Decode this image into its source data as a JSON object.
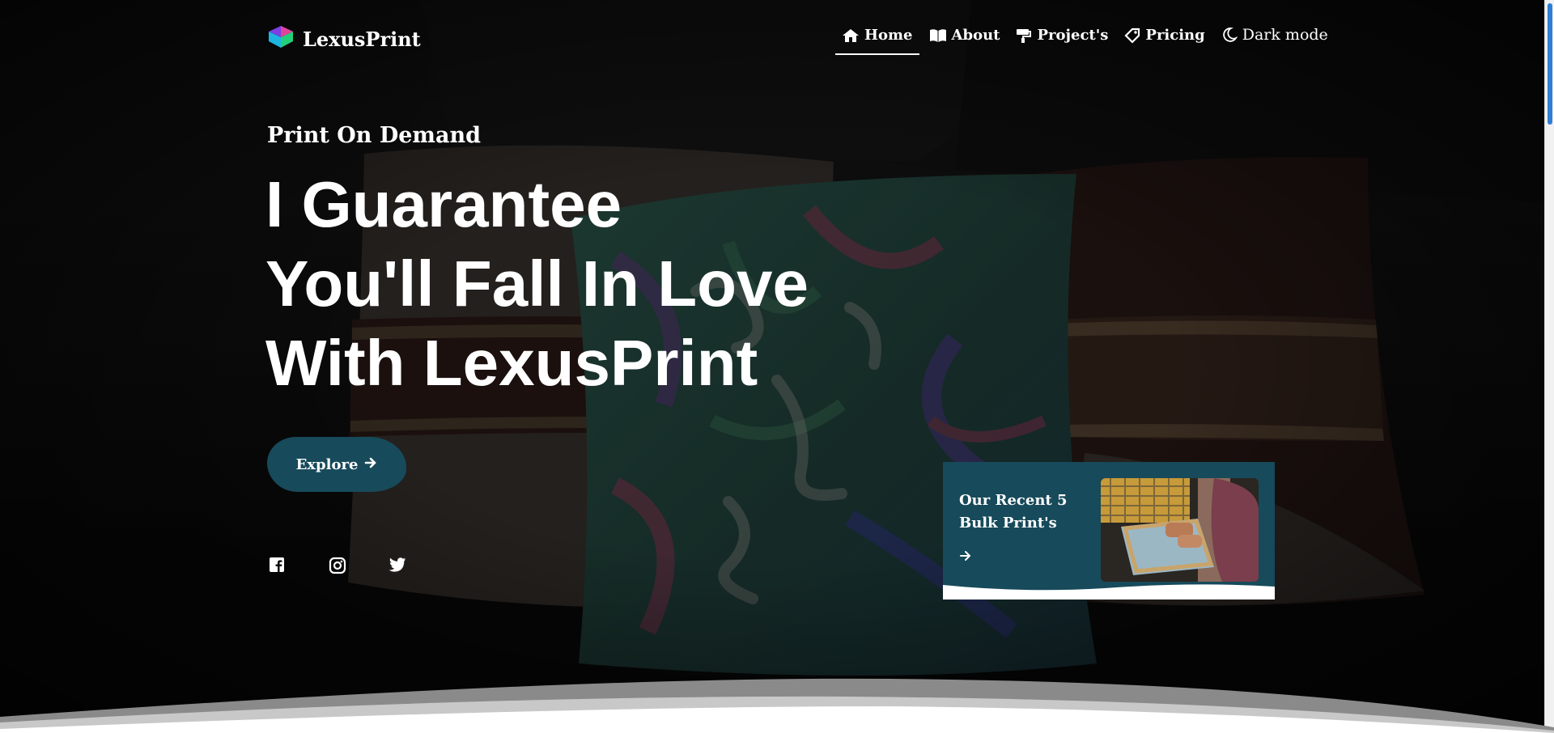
{
  "brand": {
    "name": "LexusPrint",
    "logo_icon": "cube-logo-icon"
  },
  "nav": {
    "items": [
      {
        "label": "Home",
        "icon": "home-icon",
        "active": true
      },
      {
        "label": "About",
        "icon": "book-icon",
        "active": false
      },
      {
        "label": "Project's",
        "icon": "paint-roller-icon",
        "active": false
      },
      {
        "label": "Pricing",
        "icon": "tag-icon",
        "active": false
      }
    ],
    "dark_mode": {
      "label": "Dark mode",
      "icon": "moon-icon"
    }
  },
  "hero": {
    "eyebrow": "Print On Demand",
    "line1": "I Guarantee",
    "line2_regular": "You'll",
    "line2_bold": "Fall In Love",
    "line3": "With LexusPrint",
    "explore_label": "Explore",
    "explore_icon": "arrow-right-icon"
  },
  "social": [
    "facebook-icon",
    "instagram-icon",
    "twitter-icon"
  ],
  "recent_card": {
    "title_line1": "Our Recent 5",
    "title_line2": "Bulk Print's",
    "arrow_icon": "arrow-right-icon"
  },
  "colors": {
    "accent": "#174a5a",
    "background": "#0a0a0a",
    "text": "#ffffff"
  }
}
